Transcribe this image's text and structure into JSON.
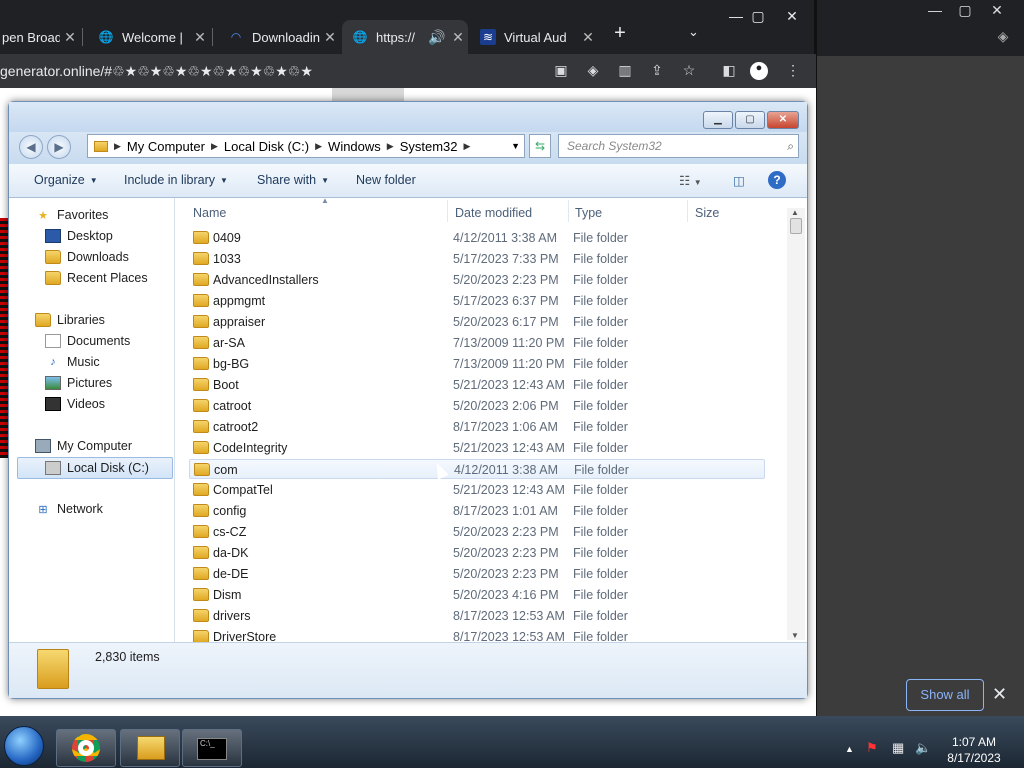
{
  "chrome": {
    "tabs": [
      {
        "label": "pen Broad",
        "icon": "globe-icon"
      },
      {
        "label": "Welcome | ",
        "icon": "globe-icon"
      },
      {
        "label": "Downloadin",
        "icon": "loading-icon"
      },
      {
        "label": "https://",
        "icon": "globe-icon",
        "audio": "speaker-icon"
      },
      {
        "label": "Virtual Aud",
        "icon": "audio-app-icon"
      }
    ],
    "url": "generator.online/#♲★♲★♲★♲★♲★♲★♲★♲★"
  },
  "explorer": {
    "address": [
      "My Computer",
      "Local Disk (C:)",
      "Windows",
      "System32"
    ],
    "search_placeholder": "Search System32",
    "commands": {
      "organize": "Organize",
      "include": "Include in library",
      "share": "Share with",
      "newfolder": "New folder"
    },
    "nav": {
      "favorites": "Favorites",
      "desktop": "Desktop",
      "downloads": "Downloads",
      "recent": "Recent Places",
      "libraries": "Libraries",
      "documents": "Documents",
      "music": "Music",
      "pictures": "Pictures",
      "videos": "Videos",
      "mycomputer": "My Computer",
      "localdisk": "Local Disk (C:)",
      "network": "Network"
    },
    "columns": {
      "name": "Name",
      "date": "Date modified",
      "type": "Type",
      "size": "Size"
    },
    "files": [
      {
        "name": "0409",
        "date": "4/12/2011 3:38 AM",
        "type": "File folder"
      },
      {
        "name": "1033",
        "date": "5/17/2023 7:33 PM",
        "type": "File folder"
      },
      {
        "name": "AdvancedInstallers",
        "date": "5/20/2023 2:23 PM",
        "type": "File folder"
      },
      {
        "name": "appmgmt",
        "date": "5/17/2023 6:37 PM",
        "type": "File folder"
      },
      {
        "name": "appraiser",
        "date": "5/20/2023 6:17 PM",
        "type": "File folder"
      },
      {
        "name": "ar-SA",
        "date": "7/13/2009 11:20 PM",
        "type": "File folder"
      },
      {
        "name": "bg-BG",
        "date": "7/13/2009 11:20 PM",
        "type": "File folder"
      },
      {
        "name": "Boot",
        "date": "5/21/2023 12:43 AM",
        "type": "File folder"
      },
      {
        "name": "catroot",
        "date": "5/20/2023 2:06 PM",
        "type": "File folder"
      },
      {
        "name": "catroot2",
        "date": "8/17/2023 1:06 AM",
        "type": "File folder"
      },
      {
        "name": "CodeIntegrity",
        "date": "5/21/2023 12:43 AM",
        "type": "File folder"
      },
      {
        "name": "com",
        "date": "4/12/2011 3:38 AM",
        "type": "File folder"
      },
      {
        "name": "CompatTel",
        "date": "5/21/2023 12:43 AM",
        "type": "File folder"
      },
      {
        "name": "config",
        "date": "8/17/2023 1:01 AM",
        "type": "File folder"
      },
      {
        "name": "cs-CZ",
        "date": "5/20/2023 2:23 PM",
        "type": "File folder"
      },
      {
        "name": "da-DK",
        "date": "5/20/2023 2:23 PM",
        "type": "File folder"
      },
      {
        "name": "de-DE",
        "date": "5/20/2023 2:23 PM",
        "type": "File folder"
      },
      {
        "name": "Dism",
        "date": "5/20/2023 4:16 PM",
        "type": "File folder"
      },
      {
        "name": "drivers",
        "date": "8/17/2023 12:53 AM",
        "type": "File folder"
      },
      {
        "name": "DriverStore",
        "date": "8/17/2023 12:53 AM",
        "type": "File folder"
      }
    ],
    "item_count": "2,830 items"
  },
  "downloads_bar": {
    "show_all": "Show all"
  },
  "taskbar": {
    "time": "1:07 AM",
    "date": "8/17/2023"
  }
}
